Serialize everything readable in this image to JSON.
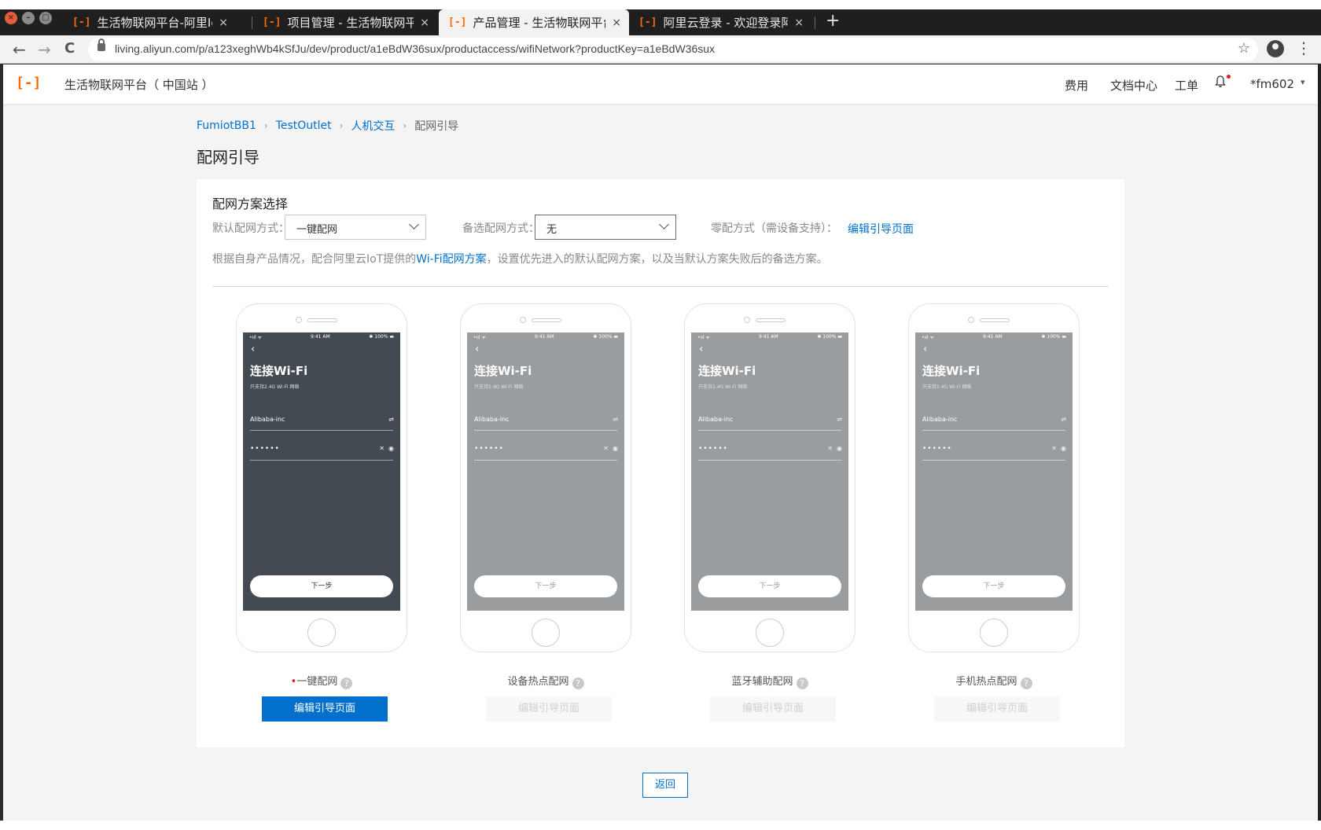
{
  "browser": {
    "window_buttons": [
      "×",
      "–",
      "□"
    ],
    "tabs": [
      {
        "title": "生活物联网平台-阿里IoT生",
        "favicon": "[-]",
        "close": "×"
      },
      {
        "title": "项目管理 - 生活物联网平台",
        "favicon": "[-]",
        "close": "×"
      },
      {
        "title": "产品管理 - 生活物联网平台",
        "favicon": "[-]",
        "close": "×"
      },
      {
        "title": "阿里云登录 - 欢迎登录阿里",
        "favicon": "[-]",
        "close": "×"
      }
    ],
    "new_tab": "+",
    "back": "←",
    "forward": "→",
    "reload": "C",
    "url": "living.aliyun.com/p/a123xeghWb4kSfJu/dev/product/a1eBdW36sux/productaccess/wifiNetwork?productKey=a1eBdW36sux",
    "star": "☆",
    "kebab": "⋮"
  },
  "topnav": {
    "logo": "[-]",
    "platform": "生活物联网平台（ 中国站 ）",
    "links": [
      "费用",
      "文档中心",
      "工单"
    ],
    "bell": "🔔",
    "user": "*fm602",
    "caret": "▾"
  },
  "breadcrumb": {
    "items": [
      "FumiotBB1",
      "TestOutlet",
      "人机交互"
    ],
    "current": "配网引导",
    "sep": "›"
  },
  "page_title": "配网引导",
  "card": {
    "title": "配网方案选择",
    "default_label": "默认配网方式：",
    "default_value": "一键配网",
    "backup_label": "备选配网方式：",
    "backup_value": "无",
    "zero_label": "零配方式（需设备支持）：",
    "zero_link": "编辑引导页面",
    "desc_prefix": "根据自身产品情况，配合阿里云IoT提供的",
    "desc_link": "Wi-Fi配网方案",
    "desc_suffix": "，设置优先进入的默认配网方案，以及当默认方案失败后的备选方案。"
  },
  "phone_screen": {
    "signal": "•ııl ᯤ",
    "time": "9:41 AM",
    "battery": "✱ 100% ▬",
    "back": "‹",
    "title": "连接Wi-Fi",
    "subtitle": "只支持2.4G Wi-Fi 网络",
    "ssid": "Alibaba-inc",
    "switch_icon": "⇌",
    "password": "••••••",
    "clear_icon": "✕",
    "eye_icon": "◉",
    "next": "下一步"
  },
  "options": [
    {
      "label": "一键配网",
      "required": "•",
      "help": "?",
      "button": "编辑引导页面"
    },
    {
      "label": "设备热点配网",
      "help": "?",
      "button": "编辑引导页面"
    },
    {
      "label": "蓝牙辅助配网",
      "help": "?",
      "button": "编辑引导页面"
    },
    {
      "label": "手机热点配网",
      "help": "?",
      "button": "编辑引导页面"
    }
  ],
  "return_button": "返回",
  "colors": {
    "accent": "#0070cc",
    "brand": "#ff6a00",
    "phone_dark": "#434a52",
    "phone_light": "#9a9d9f"
  }
}
